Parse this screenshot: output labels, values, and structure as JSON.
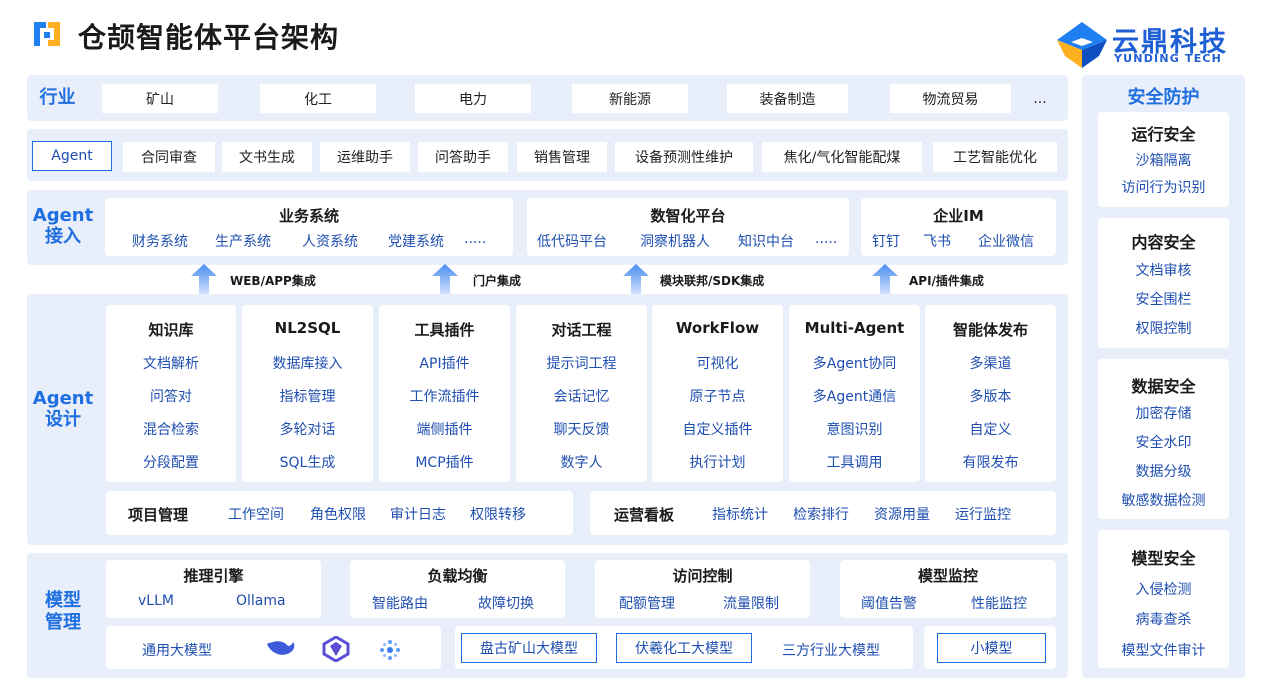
{
  "title": "仓颉智能体平台架构",
  "brand": {
    "cn": "云鼎科技",
    "en": "YUNDING TECH"
  },
  "industry": {
    "label": "行业",
    "items": [
      "矿山",
      "化工",
      "电力",
      "新能源",
      "装备制造",
      "物流贸易",
      "..."
    ]
  },
  "agent_row": {
    "label": "Agent",
    "items": [
      "合同审查",
      "文书生成",
      "运维助手",
      "问答助手",
      "销售管理",
      "设备预测性维护",
      "焦化/气化智能配煤",
      "工艺智能优化"
    ]
  },
  "access": {
    "label_top": "Agent",
    "label_bottom": "接入",
    "groups": [
      {
        "title": "业务系统",
        "items": [
          "财务系统",
          "生产系统",
          "人资系统",
          "党建系统",
          "....."
        ]
      },
      {
        "title": "数智化平台",
        "items": [
          "低代码平台",
          "洞察机器人",
          "知识中台",
          "....."
        ]
      },
      {
        "title": "企业IM",
        "items": [
          "钉钉",
          "飞书",
          "企业微信"
        ]
      }
    ],
    "integrations": [
      "WEB/APP集成",
      "门户集成",
      "模块联邦/SDK集成",
      "API/插件集成"
    ]
  },
  "design": {
    "label_top": "Agent",
    "label_bottom": "设计",
    "columns": [
      {
        "title": "知识库",
        "items": [
          "文档解析",
          "问答对",
          "混合检索",
          "分段配置"
        ]
      },
      {
        "title": "NL2SQL",
        "items": [
          "数据库接入",
          "指标管理",
          "多轮对话",
          "SQL生成"
        ]
      },
      {
        "title": "工具插件",
        "items": [
          "API插件",
          "工作流插件",
          "端侧插件",
          "MCP插件"
        ]
      },
      {
        "title": "对话工程",
        "items": [
          "提示词工程",
          "会话记忆",
          "聊天反馈",
          "数字人"
        ]
      },
      {
        "title": "WorkFlow",
        "items": [
          "可视化",
          "原子节点",
          "自定义插件",
          "执行计划"
        ]
      },
      {
        "title": "Multi-Agent",
        "items": [
          "多Agent协同",
          "多Agent通信",
          "意图识别",
          "工具调用"
        ]
      },
      {
        "title": "智能体发布",
        "items": [
          "多渠道",
          "多版本",
          "自定义",
          "有限发布"
        ]
      }
    ],
    "project": {
      "title": "项目管理",
      "items": [
        "工作空间",
        "角色权限",
        "审计日志",
        "权限转移"
      ]
    },
    "ops": {
      "title": "运营看板",
      "items": [
        "指标统计",
        "检索排行",
        "资源用量",
        "运行监控"
      ]
    }
  },
  "model": {
    "label_top": "模型",
    "label_bottom": "管理",
    "groups": [
      {
        "title": "推理引擎",
        "items": [
          "vLLM",
          "Ollama"
        ]
      },
      {
        "title": "负载均衡",
        "items": [
          "智能路由",
          "故障切换"
        ]
      },
      {
        "title": "访问控制",
        "items": [
          "配额管理",
          "流量限制"
        ]
      },
      {
        "title": "模型监控",
        "items": [
          "阈值告警",
          "性能监控"
        ]
      }
    ],
    "general": "通用大模型",
    "pangu": "盘古矿山大模型",
    "fuxi": "伏羲化工大模型",
    "third": "三方行业大模型",
    "small": "小模型"
  },
  "security": {
    "title": "安全防护",
    "sections": [
      {
        "title": "运行安全",
        "items": [
          "沙箱隔离",
          "访问行为识别"
        ]
      },
      {
        "title": "内容安全",
        "items": [
          "文档审核",
          "安全围栏",
          "权限控制"
        ]
      },
      {
        "title": "数据安全",
        "items": [
          "加密存储",
          "安全水印",
          "数据分级",
          "敏感数据检测"
        ]
      },
      {
        "title": "模型安全",
        "items": [
          "入侵检测",
          "病毒查杀",
          "模型文件审计"
        ]
      }
    ]
  },
  "colors": {
    "accent": "#1f6fe0",
    "band": "#e9eefb",
    "text": "#1f4fb0"
  }
}
